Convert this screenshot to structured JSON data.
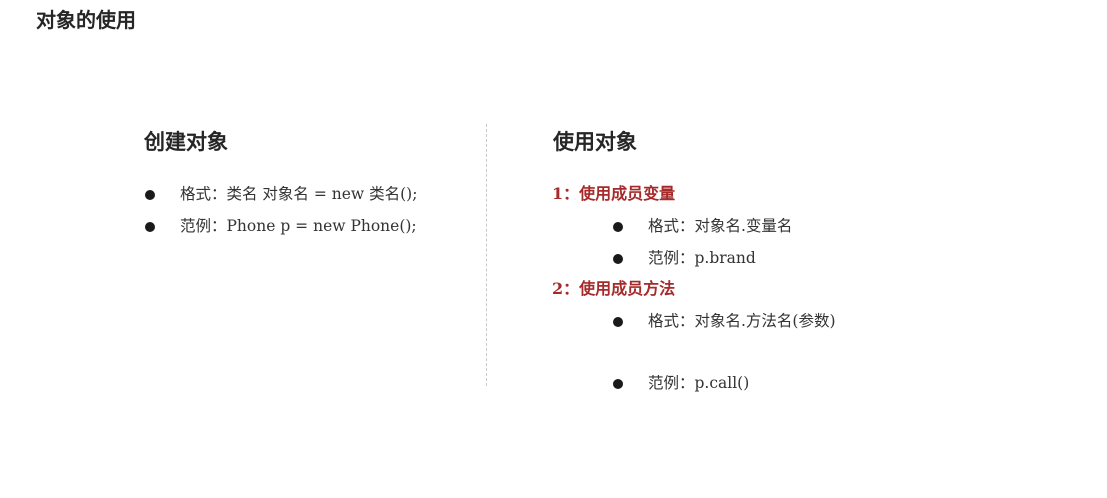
{
  "page": {
    "title": "对象的使用"
  },
  "left": {
    "heading": "创建对象",
    "items": [
      {
        "text": "格式：类名 对象名 = new 类名();"
      },
      {
        "text": "范例：Phone p = new Phone();"
      }
    ]
  },
  "right": {
    "heading": "使用对象",
    "groups": [
      {
        "title": "1：使用成员变量",
        "items": [
          {
            "text": "格式：对象名.变量名"
          },
          {
            "text": "范例：p.brand"
          }
        ]
      },
      {
        "title": "2：使用成员方法",
        "items": [
          {
            "text": "格式：对象名.方法名(参数)"
          },
          {
            "text": "范例：p.call()"
          }
        ]
      }
    ]
  },
  "colors": {
    "accent": "#a62a2a",
    "text": "#333333",
    "heading": "#262626"
  }
}
